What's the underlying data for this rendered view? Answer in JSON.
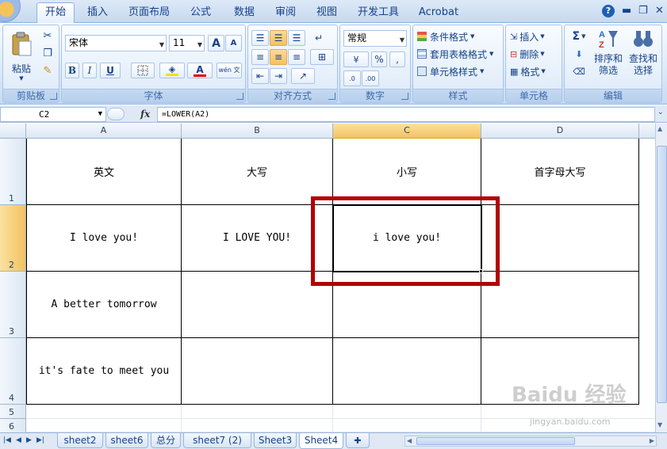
{
  "ribbon_tabs": [
    "开始",
    "插入",
    "页面布局",
    "公式",
    "数据",
    "审阅",
    "视图",
    "开发工具",
    "Acrobat"
  ],
  "window": {
    "help": "?",
    "minimize": "▬",
    "restore": "❐",
    "close": "✕"
  },
  "clipboard": {
    "paste": "粘贴",
    "label": "剪贴板",
    "icons": [
      "scissors-icon",
      "copy-icon",
      "format-painter-icon"
    ]
  },
  "font": {
    "name": "宋体",
    "size": "11",
    "grow": "A",
    "shrink": "A",
    "bold": "B",
    "italic": "I",
    "underline": "U",
    "font_color_glyph": "A",
    "wen": "wén 文",
    "label": "字体",
    "font_color": "#e00000",
    "fill_color": "#f3e100"
  },
  "alignment": {
    "label": "对齐方式"
  },
  "number": {
    "format": "常规",
    "percent": "%",
    "comma": ",",
    "label": "数字"
  },
  "styles": {
    "conditional": "条件格式",
    "table_format": "套用表格格式",
    "cell_styles": "单元格样式",
    "label": "样式"
  },
  "cells_group": {
    "insert": "插入",
    "delete": "删除",
    "format": "格式",
    "label": "单元格"
  },
  "editing": {
    "sum": "Σ",
    "sort": "排序和\n筛选",
    "find": "查找和\n选择",
    "label": "编辑"
  },
  "formula_bar": {
    "name_box": "C2",
    "fx": "fx",
    "formula": "=LOWER(A2)"
  },
  "grid": {
    "columns": [
      "A",
      "B",
      "C",
      "D"
    ],
    "rows": [
      "1",
      "2",
      "3",
      "4",
      "5",
      "6"
    ],
    "selected_col": "C",
    "selected_row": "2",
    "cells": {
      "A1": "英文",
      "B1": "大写",
      "C1": "小写",
      "D1": "首字母大写",
      "A2": "I love you!",
      "B2": "I LOVE YOU!",
      "C2": "i love you!",
      "A3": "A better tomorrow",
      "A4": "it's fate to meet you"
    },
    "highlight_color": "#b20000"
  },
  "sheet_tabs": [
    "sheet2",
    "sheet6",
    "总分",
    "sheet7 (2)",
    "Sheet3",
    "Sheet4"
  ],
  "active_sheet": "Sheet4",
  "watermark": {
    "main": "Baidu 经验",
    "sub": "jingyan.baidu.com"
  }
}
